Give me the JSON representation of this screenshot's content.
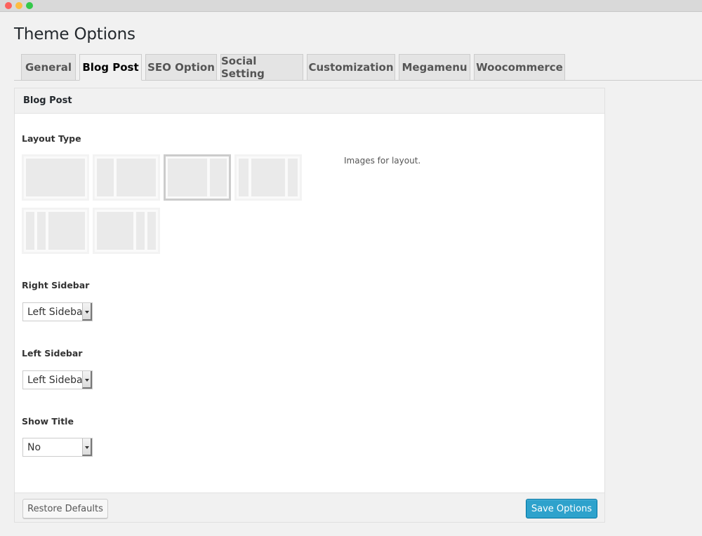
{
  "page": {
    "title": "Theme Options"
  },
  "tabs": [
    {
      "label": "General"
    },
    {
      "label": "Blog Post"
    },
    {
      "label": "SEO Option"
    },
    {
      "label": "Social Setting"
    },
    {
      "label": "Customization"
    },
    {
      "label": "Megamenu"
    },
    {
      "label": "Woocommerce"
    }
  ],
  "active_tab": "Blog Post",
  "panel": {
    "title": "Blog Post",
    "layout_type": {
      "label": "Layout Type",
      "description": "Images for layout.",
      "options": [
        {
          "name": "full-width"
        },
        {
          "name": "left-sidebar"
        },
        {
          "name": "right-sidebar"
        },
        {
          "name": "both-sidebars"
        },
        {
          "name": "two-left-sidebars"
        },
        {
          "name": "two-right-sidebars"
        }
      ],
      "selected": "right-sidebar"
    },
    "right_sidebar": {
      "label": "Right Sidebar",
      "value": "Left Sidebar"
    },
    "left_sidebar": {
      "label": "Left Sidebar",
      "value": "Left Sidebar"
    },
    "show_title": {
      "label": "Show Title",
      "value": "No"
    }
  },
  "footer": {
    "restore_label": "Restore Defaults",
    "save_label": "Save Options"
  },
  "colors": {
    "accent": "#2ea2cc",
    "traffic_close": "#fc615d",
    "traffic_min": "#fdbc40",
    "traffic_max": "#34c84a"
  }
}
